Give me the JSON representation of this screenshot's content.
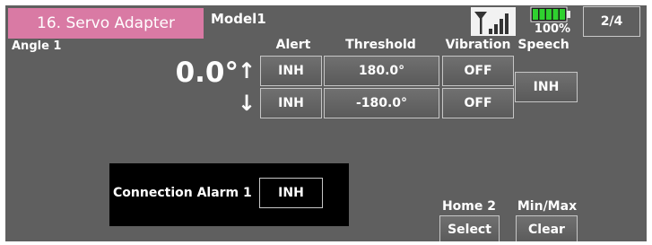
{
  "header": {
    "title": "16. Servo Adapter",
    "model": "Model1",
    "battery_percent": "100%",
    "page": "2/4",
    "icons": {
      "signal": "signal-strength-icon",
      "battery": "battery-icon"
    },
    "colors": {
      "title_tab": "#d97aa4",
      "background": "#5f5f5f",
      "battery": "#2fd12f"
    }
  },
  "channel": {
    "name": "Angle 1",
    "angle": "0.0°",
    "up_arrow": "↑",
    "down_arrow": "↓"
  },
  "columns": {
    "alert": "Alert",
    "threshold": "Threshold",
    "vibration": "Vibration",
    "speech": "Speech"
  },
  "rows": [
    {
      "alert": "INH",
      "threshold": "180.0°",
      "vibration": "OFF"
    },
    {
      "alert": "INH",
      "threshold": "-180.0°",
      "vibration": "OFF"
    }
  ],
  "speech": {
    "value": "INH"
  },
  "connection_alarm": {
    "label": "Connection Alarm 1",
    "value": "INH"
  },
  "bottom": {
    "home_label": "Home 2",
    "select_label": "Select",
    "minmax_label": "Min/Max",
    "clear_label": "Clear"
  }
}
